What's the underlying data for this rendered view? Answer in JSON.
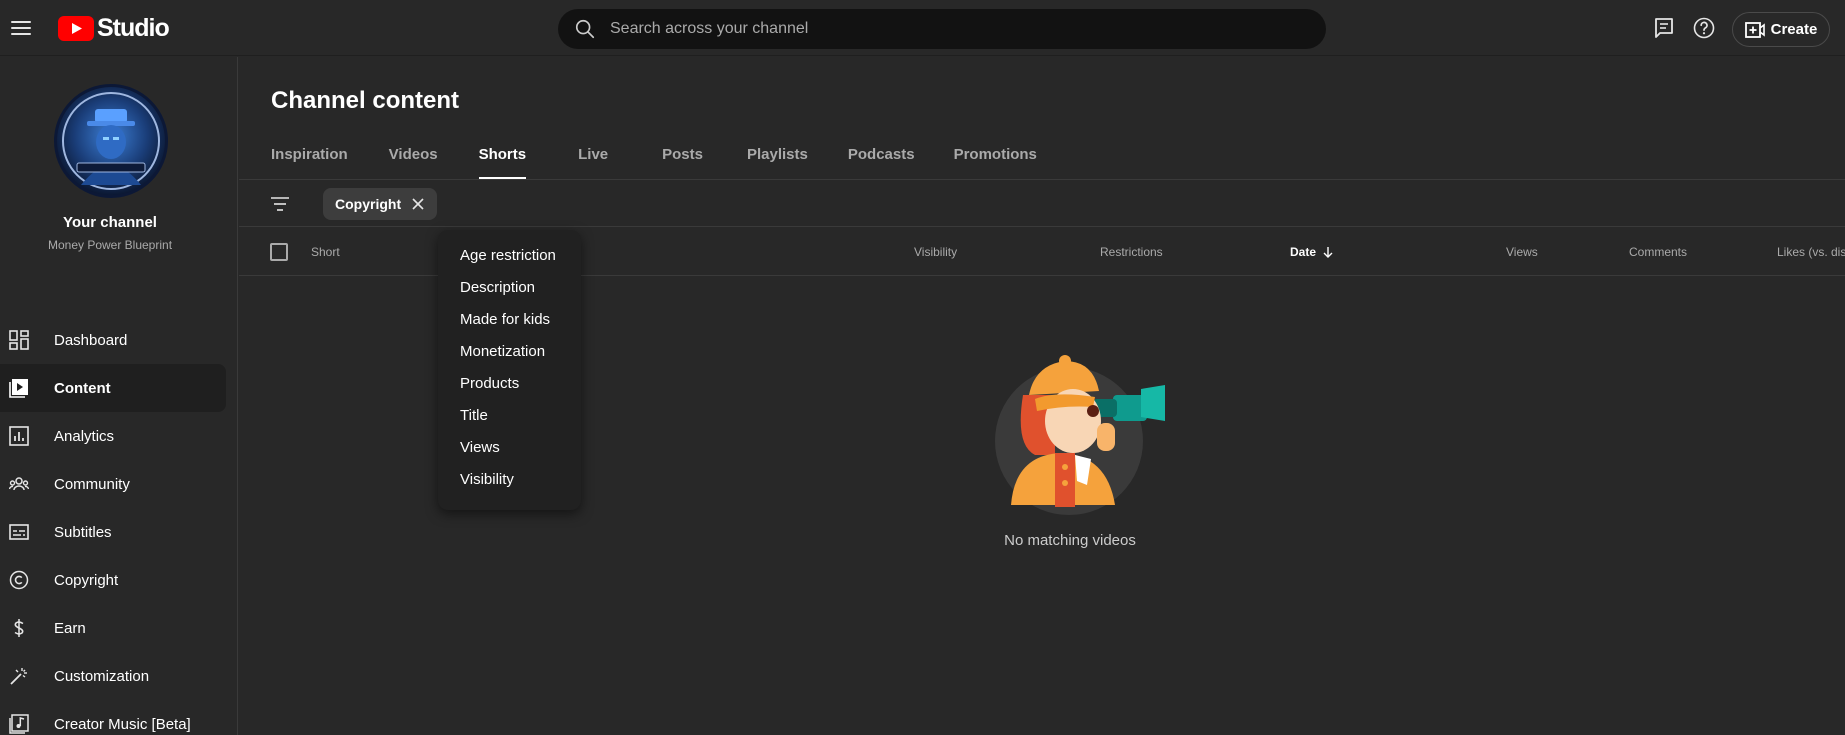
{
  "app": {
    "logo_text": "Studio"
  },
  "search": {
    "placeholder": "Search across your channel"
  },
  "header": {
    "create_label": "Create"
  },
  "channel": {
    "title": "Your channel",
    "name": "Money Power Blueprint"
  },
  "sidebar": {
    "items": [
      {
        "label": "Dashboard",
        "icon": "dashboard-icon",
        "active": false
      },
      {
        "label": "Content",
        "icon": "content-icon",
        "active": true
      },
      {
        "label": "Analytics",
        "icon": "analytics-icon",
        "active": false
      },
      {
        "label": "Community",
        "icon": "community-icon",
        "active": false
      },
      {
        "label": "Subtitles",
        "icon": "subtitles-icon",
        "active": false
      },
      {
        "label": "Copyright",
        "icon": "copyright-icon",
        "active": false
      },
      {
        "label": "Earn",
        "icon": "dollar-icon",
        "active": false
      },
      {
        "label": "Customization",
        "icon": "magic-wand-icon",
        "active": false
      },
      {
        "label": "Creator Music [Beta]",
        "icon": "music-note-icon",
        "active": false
      }
    ]
  },
  "main": {
    "title": "Channel content",
    "tabs": [
      {
        "label": "Inspiration",
        "active": false
      },
      {
        "label": "Videos",
        "active": false
      },
      {
        "label": "Shorts",
        "active": true
      },
      {
        "label": "Live",
        "active": false
      },
      {
        "label": "Posts",
        "active": false
      },
      {
        "label": "Playlists",
        "active": false
      },
      {
        "label": "Podcasts",
        "active": false
      },
      {
        "label": "Promotions",
        "active": false
      }
    ],
    "filter_chip": "Copyright",
    "columns": {
      "short": "Short",
      "visibility": "Visibility",
      "restrictions": "Restrictions",
      "date": "Date",
      "views": "Views",
      "comments": "Comments",
      "likes": "Likes (vs. dislikes)"
    },
    "empty_message": "No matching videos"
  },
  "filter_menu": {
    "items": [
      "Age restriction",
      "Description",
      "Made for kids",
      "Monetization",
      "Products",
      "Title",
      "Views",
      "Visibility"
    ]
  },
  "colors": {
    "background": "#282828",
    "sidebar_active": "#1f1f1f",
    "brand_red": "#ff0000",
    "search_bg": "#121212"
  }
}
